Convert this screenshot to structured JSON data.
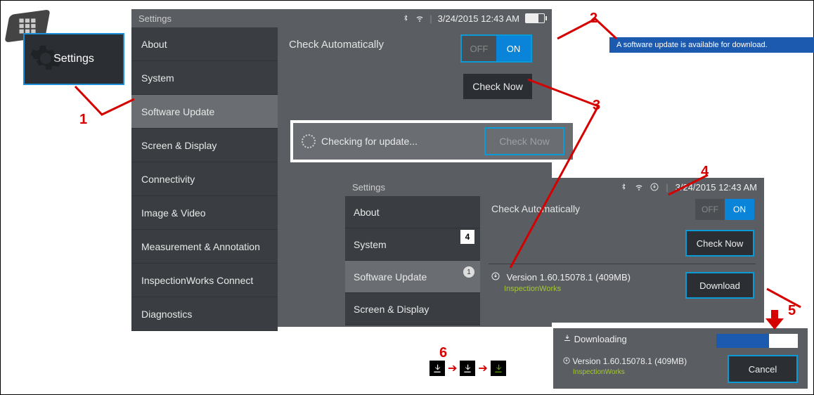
{
  "tile": {
    "label": "Settings"
  },
  "panelA": {
    "title": "Settings",
    "datetime": "3/24/2015  12:43 AM",
    "sidebar": [
      "About",
      "System",
      "Software Update",
      "Screen & Display",
      "Connectivity",
      "Image & Video",
      "Measurement & Annotation",
      "InspectionWorks Connect",
      "Diagnostics"
    ],
    "check_auto_label": "Check Automatically",
    "toggle_off": "OFF",
    "toggle_on": "ON",
    "check_now": "Check Now",
    "checking_text": "Checking for update...",
    "checking_btn": "Check Now"
  },
  "notification": "A software update is available for download.",
  "panelB": {
    "title": "Settings",
    "datetime": "3/24/2015  12:43 AM",
    "sidebar": [
      "About",
      "System",
      "Software Update",
      "Screen & Display"
    ],
    "badge_num": "4",
    "badge_count": "1",
    "check_auto_label": "Check Automatically",
    "toggle_off": "OFF",
    "toggle_on": "ON",
    "check_now": "Check Now",
    "version_line": "Version 1.60.15078.1 (409MB)",
    "version_sub": "InspectionWorks",
    "download": "Download"
  },
  "panelC": {
    "downloading": "Downloading",
    "progress_pct": 65,
    "version_line": "Version 1.60.15078.1 (409MB)",
    "version_sub": "InspectionWorks",
    "cancel": "Cancel"
  },
  "callouts": {
    "c1": "1",
    "c2": "2",
    "c3": "3",
    "c4": "4",
    "c5": "5",
    "c6": "6"
  }
}
